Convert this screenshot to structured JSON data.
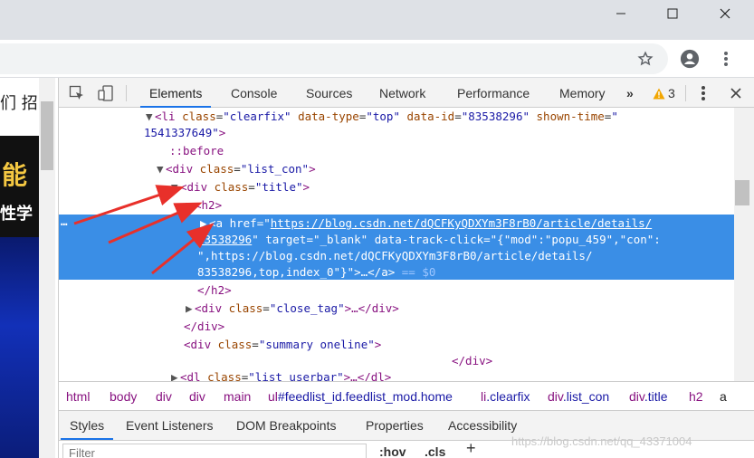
{
  "window": {
    "controls": {
      "minimize_icon": "minimize-icon",
      "maximize_icon": "maximize-icon",
      "close_icon": "close-icon"
    }
  },
  "toolbar": {
    "bookmark_icon": "star-icon",
    "profile_icon": "account-icon",
    "menu_icon": "kebab-menu-icon"
  },
  "page": {
    "nav_text": "们 招",
    "banner_text_1": "能",
    "banner_text_2": "性学"
  },
  "devtools": {
    "tabs": [
      {
        "label": "Elements",
        "active": true
      },
      {
        "label": "Console"
      },
      {
        "label": "Sources"
      },
      {
        "label": "Network"
      },
      {
        "label": "Performance"
      },
      {
        "label": "Memory"
      }
    ],
    "more_tabs": "»",
    "warnings_count": "3",
    "accent_color": "#1a73e8",
    "selection_color": "#3a8ee6",
    "dom": {
      "l1_tag_open": "<li ",
      "l1_a1": "class",
      "l1_v1": "\"clearfix\"",
      "l1_a2": "data-type",
      "l1_v2": "\"top\"",
      "l1_a3": "data-id",
      "l1_v3": "\"83538296\"",
      "l1_a4": "shown-time",
      "l1_v4a": "\"",
      "l2_v4b": "1541337649\"",
      "l2_close": ">",
      "l3_pseudo": "::before",
      "l4_tag": "<div ",
      "l4_attr": "class",
      "l4_val": "\"list_con\"",
      "l4_close": ">",
      "l5_tag": "<div ",
      "l5_attr": "class",
      "l5_val": "\"title\"",
      "l5_close": ">",
      "l6_tag": "<h2>",
      "l7_tag": "<a ",
      "l7_attr": "href",
      "l7_val": "https://blog.csdn.net/dQCFKyQDXYm3F8rB0/article/details/",
      "l8_val": "83538296",
      "l8_q": "\"",
      "l8_a1": " target",
      "l8_v1": "\"_blank\"",
      "l8_a2": " data-track-click",
      "l8_v2": "\"{\"mod\":\"popu_459\",\"con\":",
      "l9_v": "\",https://blog.csdn.net/dQCFKyQDXYm3F8rB0/article/details/",
      "l10_v": "83538296,top,index_0\"}\"",
      "l10_rest": ">…</a>",
      "l10_eq": " == $0",
      "l11_tag": "</h2>",
      "l12_tag": "<div ",
      "l12_attr": "class",
      "l12_val": "\"close_tag\"",
      "l12_rest": ">…</div>",
      "l13_tag": "</div>",
      "l14_tag": "<div ",
      "l14_attr": "class",
      "l14_val": "\"summary oneline\"",
      "l14_close": ">",
      "l15_tag": "</div>",
      "l16_tag": "<dl ",
      "l16_attr": "class",
      "l16_val": "\"list userbar\"",
      "l16_rest": ">…</dl>",
      "dots": "…"
    },
    "breadcrumbs": [
      {
        "tag": "html",
        "cls": ""
      },
      {
        "tag": "body",
        "cls": ""
      },
      {
        "tag": "div",
        "cls": ""
      },
      {
        "tag": "div",
        "cls": ""
      },
      {
        "tag": "main",
        "cls": ""
      },
      {
        "tag": "ul",
        "cls": "#feedlist_id.feedlist_mod.home"
      },
      {
        "tag": "li",
        "cls": ".clearfix"
      },
      {
        "tag": "div",
        "cls": ".list_con"
      },
      {
        "tag": "div",
        "cls": ".title"
      },
      {
        "tag": "h2",
        "cls": ""
      },
      {
        "tag": "a",
        "cls": ""
      }
    ],
    "subtabs": [
      {
        "label": "Styles",
        "active": true
      },
      {
        "label": "Event Listeners"
      },
      {
        "label": "DOM Breakpoints"
      },
      {
        "label": "Properties"
      },
      {
        "label": "Accessibility"
      }
    ],
    "filter_placeholder": "Filter",
    "hov_label": ":hov",
    "cls_label": ".cls",
    "add_label": "+",
    "watermark": "https://blog.csdn.net/qq_43371004"
  }
}
